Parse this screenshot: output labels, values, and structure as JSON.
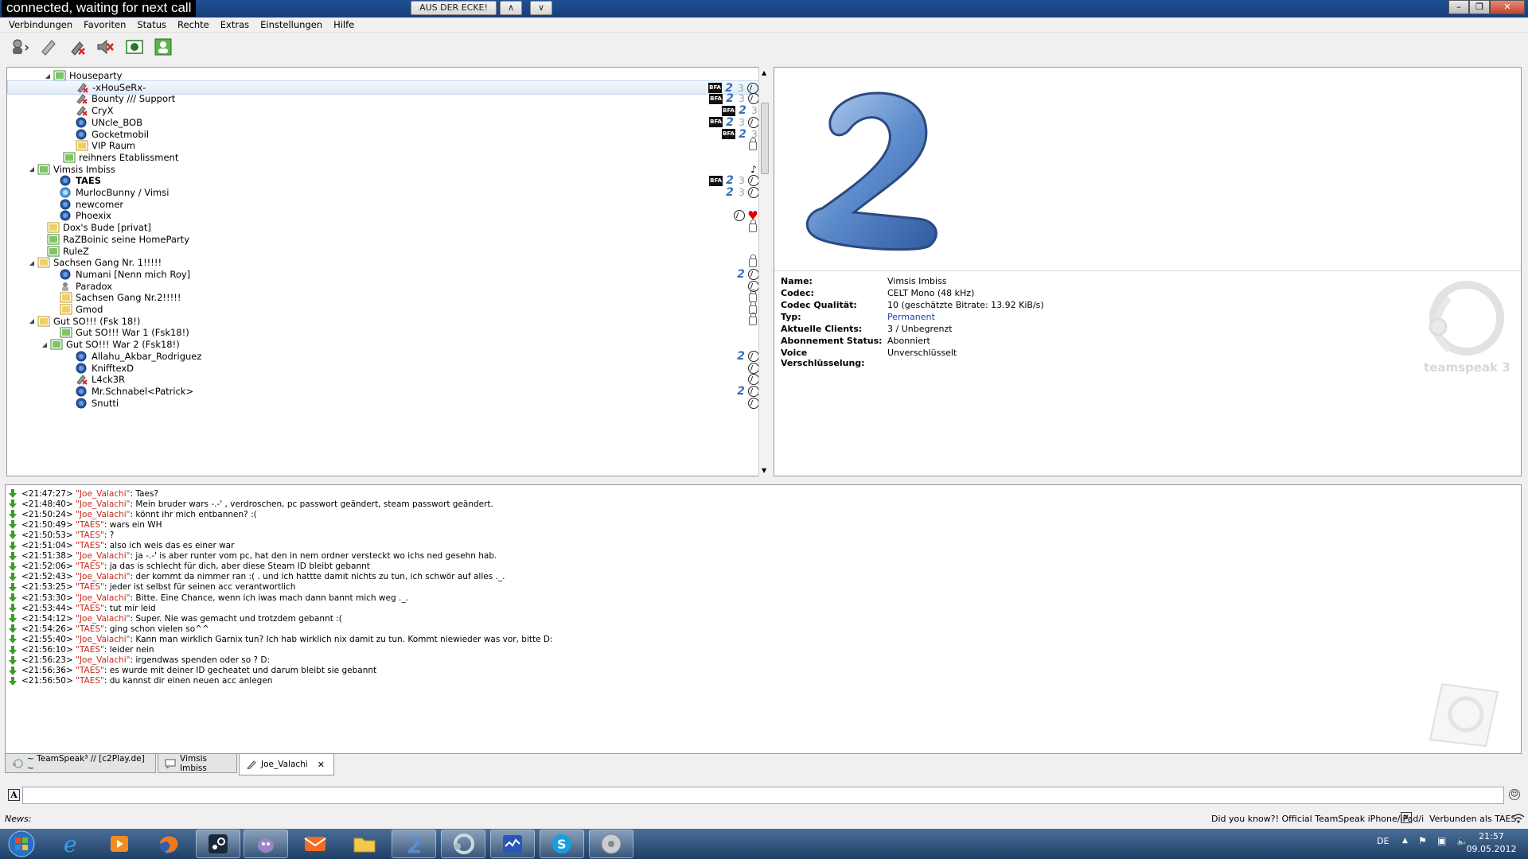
{
  "titlebar": {
    "title": "connected, waiting for next call",
    "button_main": "AUS DER ECKE!",
    "button_up": "∧",
    "button_down": "∨"
  },
  "menu": [
    "Verbindungen",
    "Favoriten",
    "Status",
    "Rechte",
    "Extras",
    "Einstellungen",
    "Hilfe"
  ],
  "tree": [
    {
      "label": "Houseparty",
      "indent": 60,
      "type": "channel",
      "tri": "◢"
    },
    {
      "label": "-xHouSeRx-",
      "indent": 84,
      "type": "user-muted",
      "selected": true,
      "badges": [
        "bfa",
        "two",
        "three",
        "ts"
      ]
    },
    {
      "label": "Bounty /// Support",
      "indent": 84,
      "type": "user-muted",
      "badges": [
        "bfa",
        "two",
        "three",
        "ts"
      ]
    },
    {
      "label": "CryX",
      "indent": 84,
      "type": "user-muted",
      "badges": [
        "bfa",
        "two",
        "three"
      ]
    },
    {
      "label": "UNcle_BOB",
      "indent": 84,
      "type": "user",
      "badges": [
        "bfa",
        "two",
        "three",
        "ts"
      ]
    },
    {
      "label": "Gocketmobil",
      "indent": 84,
      "type": "user",
      "badges": [
        "bfa",
        "two",
        "three"
      ]
    },
    {
      "label": "VIP Raum",
      "indent": 84,
      "type": "channel-locked",
      "badges": [
        "lock"
      ]
    },
    {
      "label": "reihners Etablissment",
      "indent": 68,
      "type": "channel"
    },
    {
      "label": "Vimsis Imbiss",
      "indent": 40,
      "type": "channel",
      "tri": "◢",
      "badges": [
        "note"
      ]
    },
    {
      "label": "TAES",
      "indent": 64,
      "type": "user",
      "bold": true,
      "badges": [
        "bfa",
        "two",
        "three",
        "ts"
      ]
    },
    {
      "label": "MurlocBunny / Vimsi",
      "indent": 64,
      "type": "user-light",
      "badges": [
        "two",
        "three",
        "ts"
      ]
    },
    {
      "label": "newcomer",
      "indent": 64,
      "type": "user"
    },
    {
      "label": "Phoexix",
      "indent": 64,
      "type": "user",
      "badges": [
        "ts",
        "heart"
      ]
    },
    {
      "label": "Dox's Bude [privat]",
      "indent": 48,
      "type": "channel-locked",
      "badges": [
        "lock"
      ]
    },
    {
      "label": "RaZBoinic seine HomeParty",
      "indent": 48,
      "type": "channel"
    },
    {
      "label": "RuleZ",
      "indent": 48,
      "type": "channel"
    },
    {
      "label": "Sachsen Gang Nr. 1!!!!!",
      "indent": 40,
      "type": "channel-locked",
      "tri": "◢",
      "badges": [
        "lock"
      ]
    },
    {
      "label": "Numani [Nenn mich Roy]",
      "indent": 64,
      "type": "user",
      "badges": [
        "two",
        "ts"
      ]
    },
    {
      "label": "Paradox",
      "indent": 64,
      "type": "user-away",
      "badges": [
        "ts"
      ]
    },
    {
      "label": "Sachsen Gang Nr.2!!!!!",
      "indent": 64,
      "type": "channel-locked",
      "badges": [
        "lock"
      ]
    },
    {
      "label": "Gmod",
      "indent": 64,
      "type": "channel-locked",
      "badges": [
        "lock"
      ]
    },
    {
      "label": "Gut SO!!!  (Fsk 18!)",
      "indent": 40,
      "type": "channel-locked",
      "tri": "◢",
      "badges": [
        "lock"
      ]
    },
    {
      "label": "Gut SO!!! War 1 (Fsk18!)",
      "indent": 64,
      "type": "channel"
    },
    {
      "label": "Gut SO!!! War 2 (Fsk18!)",
      "indent": 56,
      "type": "channel",
      "tri": "◢"
    },
    {
      "label": "Allahu_Akbar_Rodriguez",
      "indent": 84,
      "type": "user",
      "badges": [
        "two",
        "ts"
      ]
    },
    {
      "label": "KnifftexD",
      "indent": 84,
      "type": "user",
      "badges": [
        "ts"
      ]
    },
    {
      "label": "L4ck3R",
      "indent": 84,
      "type": "user-muted",
      "badges": [
        "ts"
      ]
    },
    {
      "label": "Mr.Schnabel<Patrick>",
      "indent": 84,
      "type": "user",
      "badges": [
        "two",
        "ts"
      ]
    },
    {
      "label": "Snutti",
      "indent": 84,
      "type": "user",
      "badges": [
        "ts"
      ]
    }
  ],
  "info": [
    {
      "key": "Name:",
      "value": "Vimsis Imbiss"
    },
    {
      "key": "Codec:",
      "value": "CELT Mono (48 kHz)"
    },
    {
      "key": "Codec Qualität:",
      "value": "10 (geschätzte Bitrate: 13.92 KiB/s)"
    },
    {
      "key": "Typ:",
      "value": "Permanent",
      "blue": true
    },
    {
      "key": "Aktuelle Clients:",
      "value": "3 / Unbegrenzt"
    },
    {
      "key": "Abonnement Status:",
      "value": "Abonniert"
    },
    {
      "key": "Voice Verschlüsselung:",
      "value": "Unverschlüsselt"
    }
  ],
  "info_logo_text": "teamspeak 3",
  "chat": [
    {
      "time": "<21:47:27>",
      "name": "\"Joe_Valachi\"",
      "text": ": Taes?"
    },
    {
      "time": "<21:48:40>",
      "name": "\"Joe_Valachi\"",
      "text": ": Mein bruder wars -.-' , verdroschen, pc passwort geändert, steam passwort geändert."
    },
    {
      "time": "<21:50:24>",
      "name": "\"Joe_Valachi\"",
      "text": ": könnt ihr mich entbannen? :("
    },
    {
      "time": "<21:50:49>",
      "name": "\"TAES\"",
      "text": ": wars ein WH"
    },
    {
      "time": "<21:50:53>",
      "name": "\"TAES\"",
      "text": ": ?"
    },
    {
      "time": "<21:51:04>",
      "name": "\"TAES\"",
      "text": ": also ich weis das es einer war"
    },
    {
      "time": "<21:51:38>",
      "name": "\"Joe_Valachi\"",
      "text": ": ja -.-' is aber runter vom pc, hat den in nem ordner versteckt wo ichs ned gesehn hab."
    },
    {
      "time": "<21:52:06>",
      "name": "\"TAES\"",
      "text": ": ja das is schlecht für dich, aber diese Steam ID bleibt gebannt"
    },
    {
      "time": "<21:52:43>",
      "name": "\"Joe_Valachi\"",
      "text": ": der kommt da nimmer ran :( . und ich hattte damit nichts zu tun, ich schwör auf alles ._."
    },
    {
      "time": "<21:53:25>",
      "name": "\"TAES\"",
      "text": ": jeder ist selbst für seinen acc verantwortlich"
    },
    {
      "time": "<21:53:30>",
      "name": "\"Joe_Valachi\"",
      "text": ": Bitte. Eine Chance, wenn ich iwas mach dann bannt mich weg ._."
    },
    {
      "time": "<21:53:44>",
      "name": "\"TAES\"",
      "text": ": tut mir leid"
    },
    {
      "time": "<21:54:12>",
      "name": "\"Joe_Valachi\"",
      "text": ": Super. Nie was gemacht und trotzdem gebannt :("
    },
    {
      "time": "<21:54:26>",
      "name": "\"TAES\"",
      "text": ": ging schon vielen so^^"
    },
    {
      "time": "<21:55:40>",
      "name": "\"Joe_Valachi\"",
      "text": ": Kann man wirklich Garnix tun? Ich hab wirklich nix damit zu tun. Kommt niewieder was vor, bitte D:"
    },
    {
      "time": "<21:56:10>",
      "name": "\"TAES\"",
      "text": ": leider nein"
    },
    {
      "time": "<21:56:23>",
      "name": "\"Joe_Valachi\"",
      "text": ": irgendwas spenden oder so ? D:"
    },
    {
      "time": "<21:56:36>",
      "name": "\"TAES\"",
      "text": ": es wurde mit deiner ID gecheatet und darum bleibt sie gebannt"
    },
    {
      "time": "<21:56:50>",
      "name": "\"TAES\"",
      "text": ": du kannst dir einen neuen acc anlegen"
    }
  ],
  "tabs": [
    {
      "label": "~ TeamSpeak³ // [c2Play.de] ~",
      "icon": "server-icon"
    },
    {
      "label": "Vimsis Imbiss",
      "icon": "channel-chat-icon"
    },
    {
      "label": "Joe_Valachi",
      "icon": "pencil-icon",
      "active": true,
      "close": "✕"
    }
  ],
  "status": {
    "news_label": "News:",
    "tip": "Did you know?! Official TeamSpeak iPhone/iPad/i",
    "tip_close": "✕",
    "connected": "Verbunden als TAES"
  },
  "tray": {
    "lang": "DE",
    "time": "21:57",
    "date": "09.05.2012"
  },
  "colors": {
    "accent": "#3b6fb8",
    "chat_name": "#c62a1a",
    "title_bg": "#1f4f94"
  }
}
